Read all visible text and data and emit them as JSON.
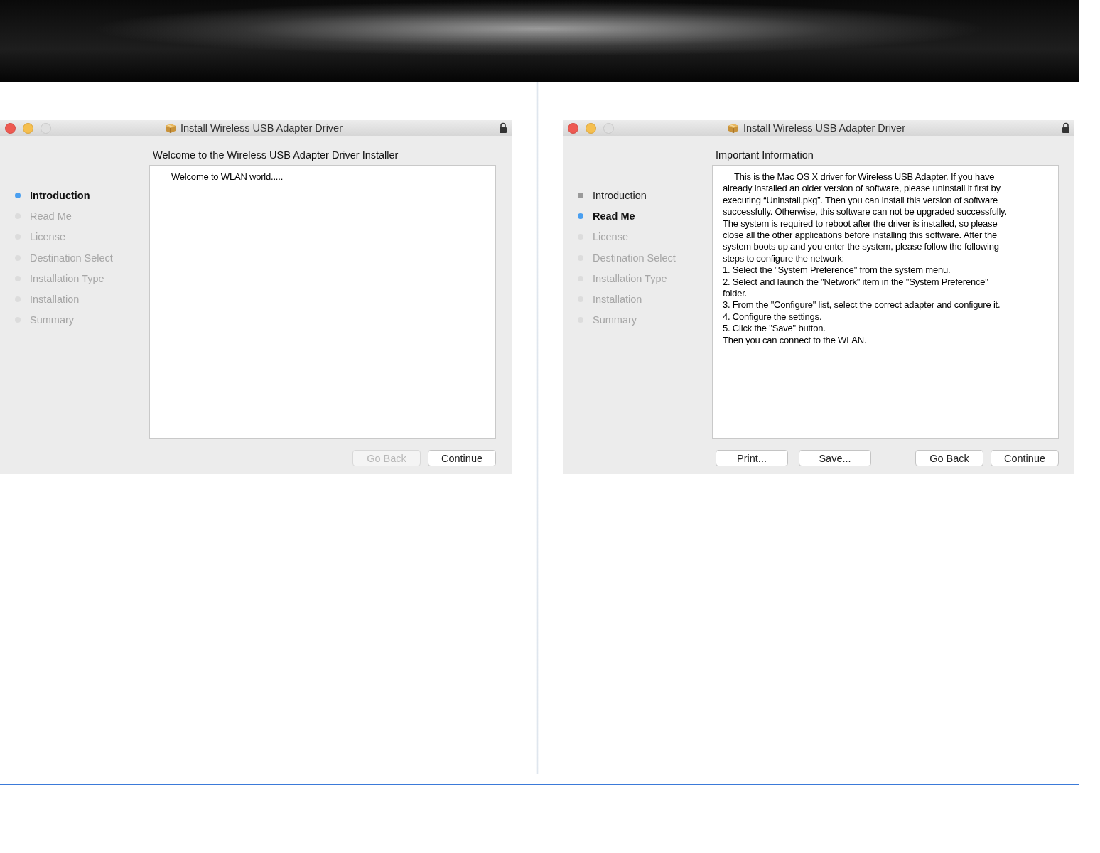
{
  "windows": [
    {
      "title": "Install Wireless USB Adapter Driver",
      "heading": "Welcome to the Wireless USB Adapter Driver Installer",
      "steps": [
        {
          "label": "Introduction",
          "selected": true,
          "completed": false
        },
        {
          "label": "Read Me",
          "selected": false,
          "completed": false
        },
        {
          "label": "License",
          "selected": false,
          "completed": false
        },
        {
          "label": "Destination Select",
          "selected": false,
          "completed": false
        },
        {
          "label": "Installation Type",
          "selected": false,
          "completed": false
        },
        {
          "label": "Installation",
          "selected": false,
          "completed": false
        },
        {
          "label": "Summary",
          "selected": false,
          "completed": false
        }
      ],
      "body": "Welcome to WLAN world.....",
      "buttons": [
        {
          "label": "Go Back",
          "kind": "navigation",
          "disabled": true
        },
        {
          "label": "Continue",
          "kind": "navigation",
          "disabled": false
        }
      ]
    },
    {
      "title": "Install Wireless USB Adapter Driver",
      "heading": "Important Information",
      "steps": [
        {
          "label": "Introduction",
          "selected": false,
          "completed": true
        },
        {
          "label": "Read Me",
          "selected": true,
          "completed": false
        },
        {
          "label": "License",
          "selected": false,
          "completed": false
        },
        {
          "label": "Destination Select",
          "selected": false,
          "completed": false
        },
        {
          "label": "Installation Type",
          "selected": false,
          "completed": false
        },
        {
          "label": "Installation",
          "selected": false,
          "completed": false
        },
        {
          "label": "Summary",
          "selected": false,
          "completed": false
        }
      ],
      "body": "This is the Mac OS X driver for Wireless USB Adapter. If you have\nalready installed an older version of software, please uninstall it first by\nexecuting “Uninstall.pkg”. Then you can install this version of software\nsuccessfully. Otherwise, this software can not be upgraded successfully.\nThe system is required to reboot after the driver is installed, so please\nclose all the other applications before installing this software. After the\nsystem boots up and you enter the system, please follow the following\nsteps to configure the network:\n1. Select the \"System Preference\" from the system menu.\n2. Select and launch the \"Network\" item in the \"System Preference\"\nfolder.\n3. From the \"Configure\" list, select the correct adapter and configure it.\n4. Configure the settings.\n5. Click the \"Save\" button.\nThen you can connect to the WLAN.",
      "buttons": [
        {
          "label": "Print...",
          "kind": "document",
          "disabled": false
        },
        {
          "label": "Save...",
          "kind": "document",
          "disabled": false
        },
        {
          "label": "Go Back",
          "kind": "navigation",
          "disabled": false
        },
        {
          "label": "Continue",
          "kind": "navigation",
          "disabled": false
        }
      ]
    }
  ]
}
